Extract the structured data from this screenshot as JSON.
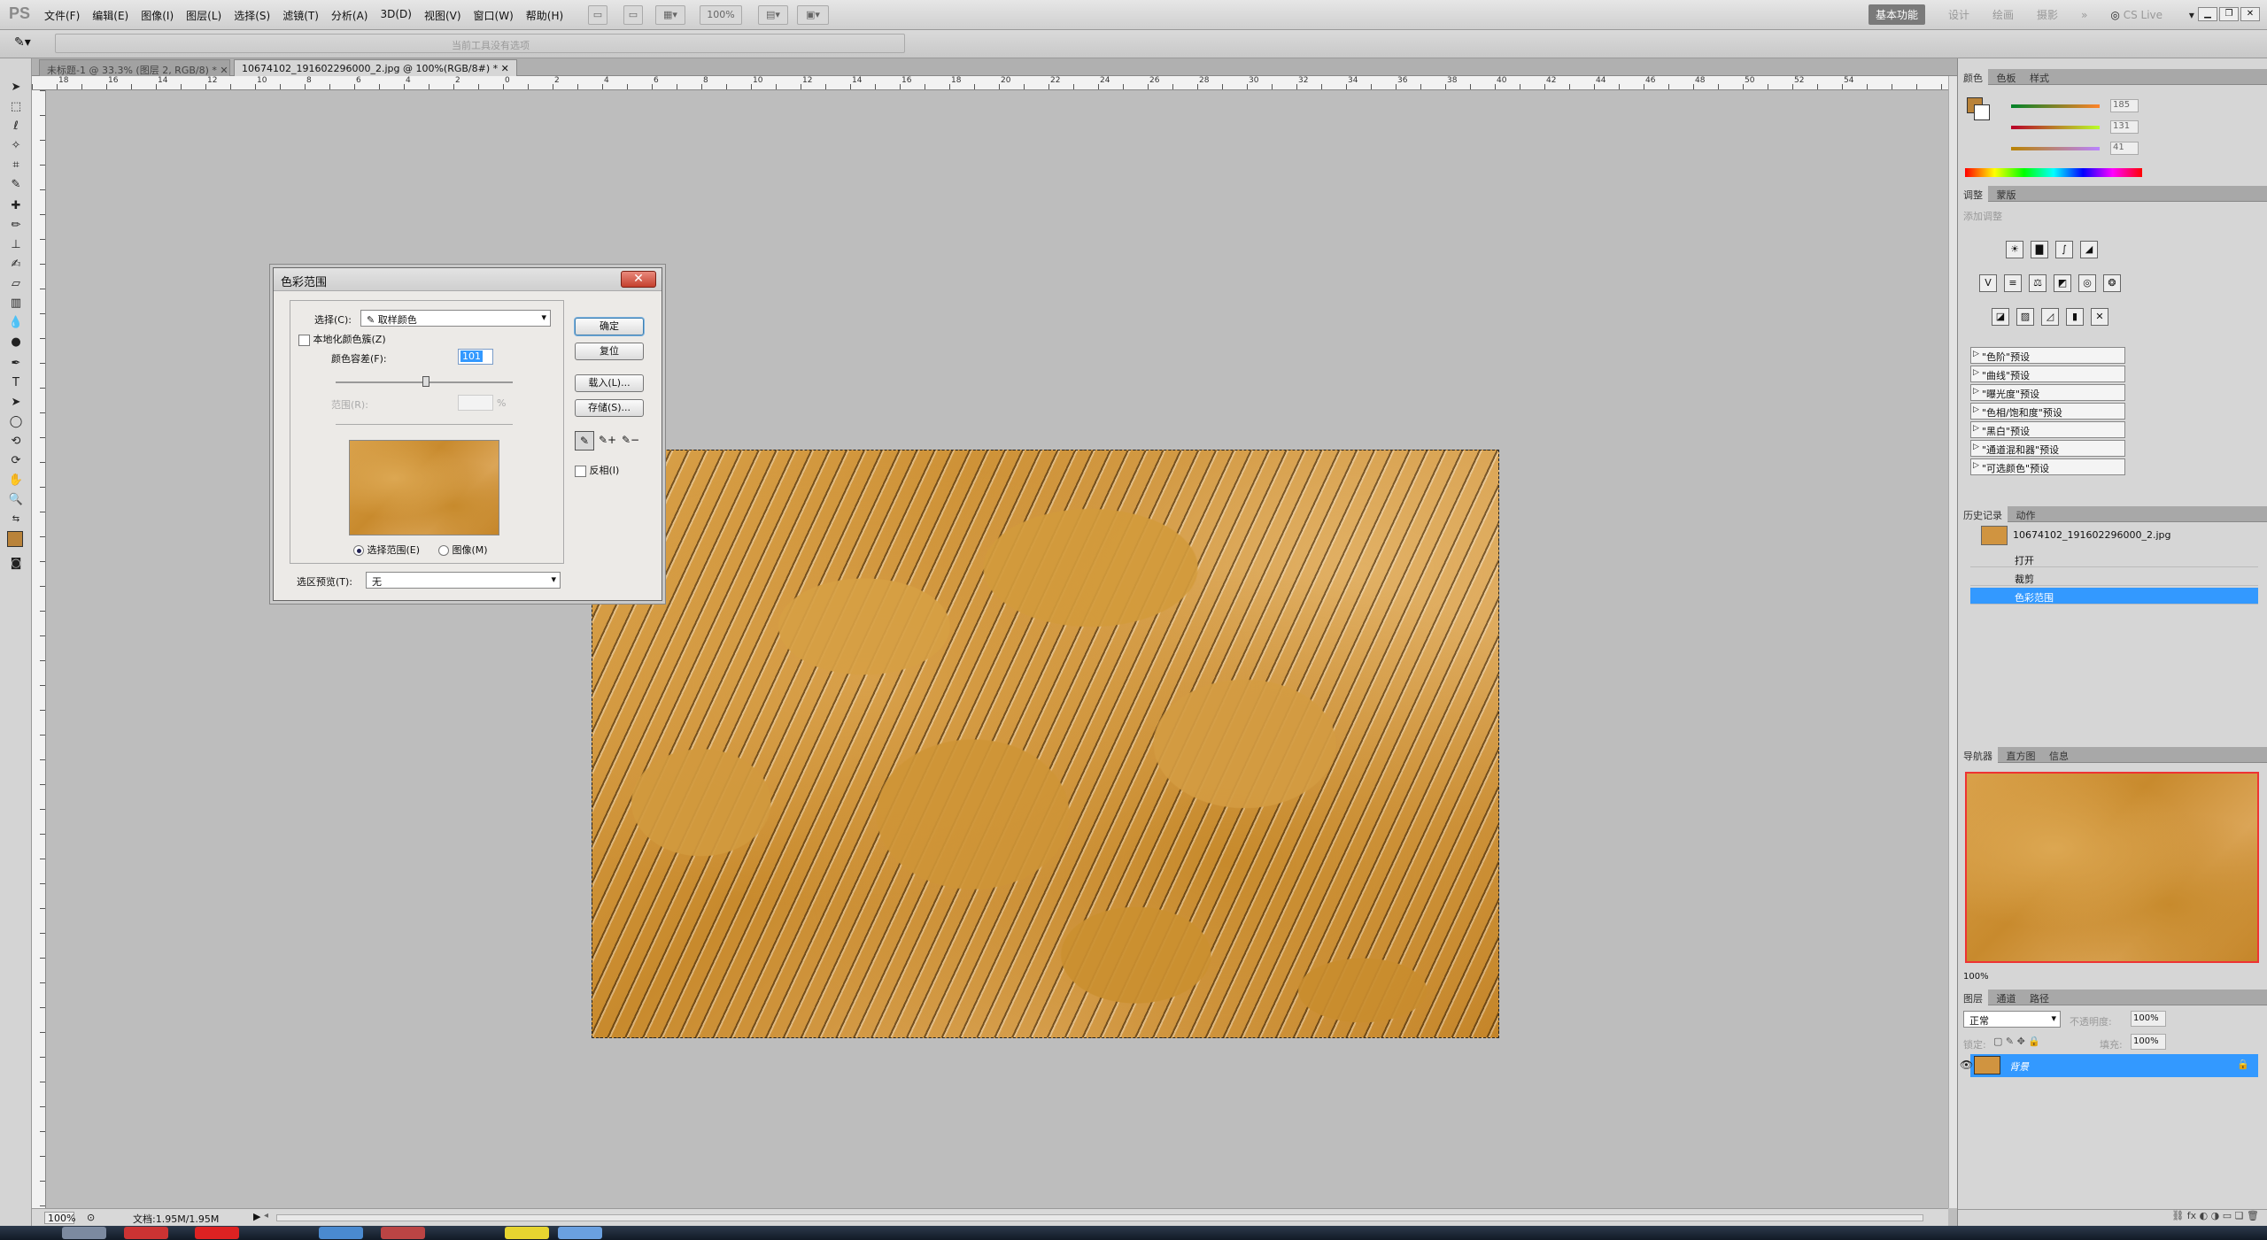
{
  "app": {
    "logo": "PS"
  },
  "menu": [
    "文件(F)",
    "编辑(E)",
    "图像(I)",
    "图层(L)",
    "选择(S)",
    "滤镜(T)",
    "分析(A)",
    "3D(D)",
    "视图(V)",
    "窗口(W)",
    "帮助(H)"
  ],
  "zoom_menu": "100%",
  "workspaces": {
    "active": "基本功能",
    "items": [
      "设计",
      "绘画",
      "摄影",
      "»"
    ]
  },
  "cslive": "CS Live",
  "optbar_hint": "当前工具没有选项",
  "doc_tabs": [
    "未标题-1 @ 33.3% (图层 2, RGB/8) *",
    "10674102_191602296000_2.jpg @ 100%(RGB/8#) *"
  ],
  "ruler_h": [
    "18",
    "16",
    "14",
    "12",
    "10",
    "8",
    "6",
    "4",
    "2",
    "0",
    "2",
    "4",
    "6",
    "8",
    "10",
    "12",
    "14",
    "16",
    "18",
    "20",
    "22",
    "24",
    "26",
    "28",
    "30",
    "32",
    "34",
    "36",
    "38",
    "40",
    "42",
    "44",
    "46",
    "48",
    "50",
    "52",
    "54"
  ],
  "status": {
    "zoom": "100%",
    "doc": "文档:1.95M/1.95M"
  },
  "color_panel": {
    "tabs": [
      "颜色",
      "色板",
      "样式"
    ],
    "fg_color": "#b9833a",
    "r": "185",
    "g": "131",
    "b": "41"
  },
  "adjust_panel": {
    "tabs": [
      "调整",
      "蒙版"
    ],
    "title": "添加调整",
    "presets": [
      "\"色阶\"预设",
      "\"曲线\"预设",
      "\"曝光度\"预设",
      "\"色相/饱和度\"预设",
      "\"黑白\"预设",
      "\"通道混和器\"预设",
      "\"可选颜色\"预设"
    ]
  },
  "history_panel": {
    "tabs": [
      "历史记录",
      "动作"
    ],
    "snapshot": "10674102_191602296000_2.jpg",
    "items": [
      "打开",
      "裁剪",
      "色彩范围"
    ]
  },
  "navigator_panel": {
    "tabs": [
      "导航器",
      "直方图",
      "信息"
    ],
    "zoom": "100%"
  },
  "layers_panel": {
    "tabs": [
      "图层",
      "通道",
      "路径"
    ],
    "blend": "正常",
    "opacity_label": "不透明度:",
    "opacity": "100%",
    "lock_label": "锁定:",
    "fill_label": "填充:",
    "fill": "100%",
    "layer_name": "背景"
  },
  "dialog": {
    "title": "色彩范围",
    "select_label": "选择(C):",
    "select_value": "取样颜色",
    "localized_label": "本地化颜色簇(Z)",
    "fuzziness_label": "颜色容差(F):",
    "fuzziness_value": "101",
    "range_label": "范围(R):",
    "range_unit": "%",
    "radio_selection": "选择范围(E)",
    "radio_image": "图像(M)",
    "preview_label": "选区预览(T):",
    "preview_value": "无",
    "ok": "确定",
    "reset": "复位",
    "load": "载入(L)...",
    "save": "存储(S)...",
    "invert": "反相(I)"
  }
}
